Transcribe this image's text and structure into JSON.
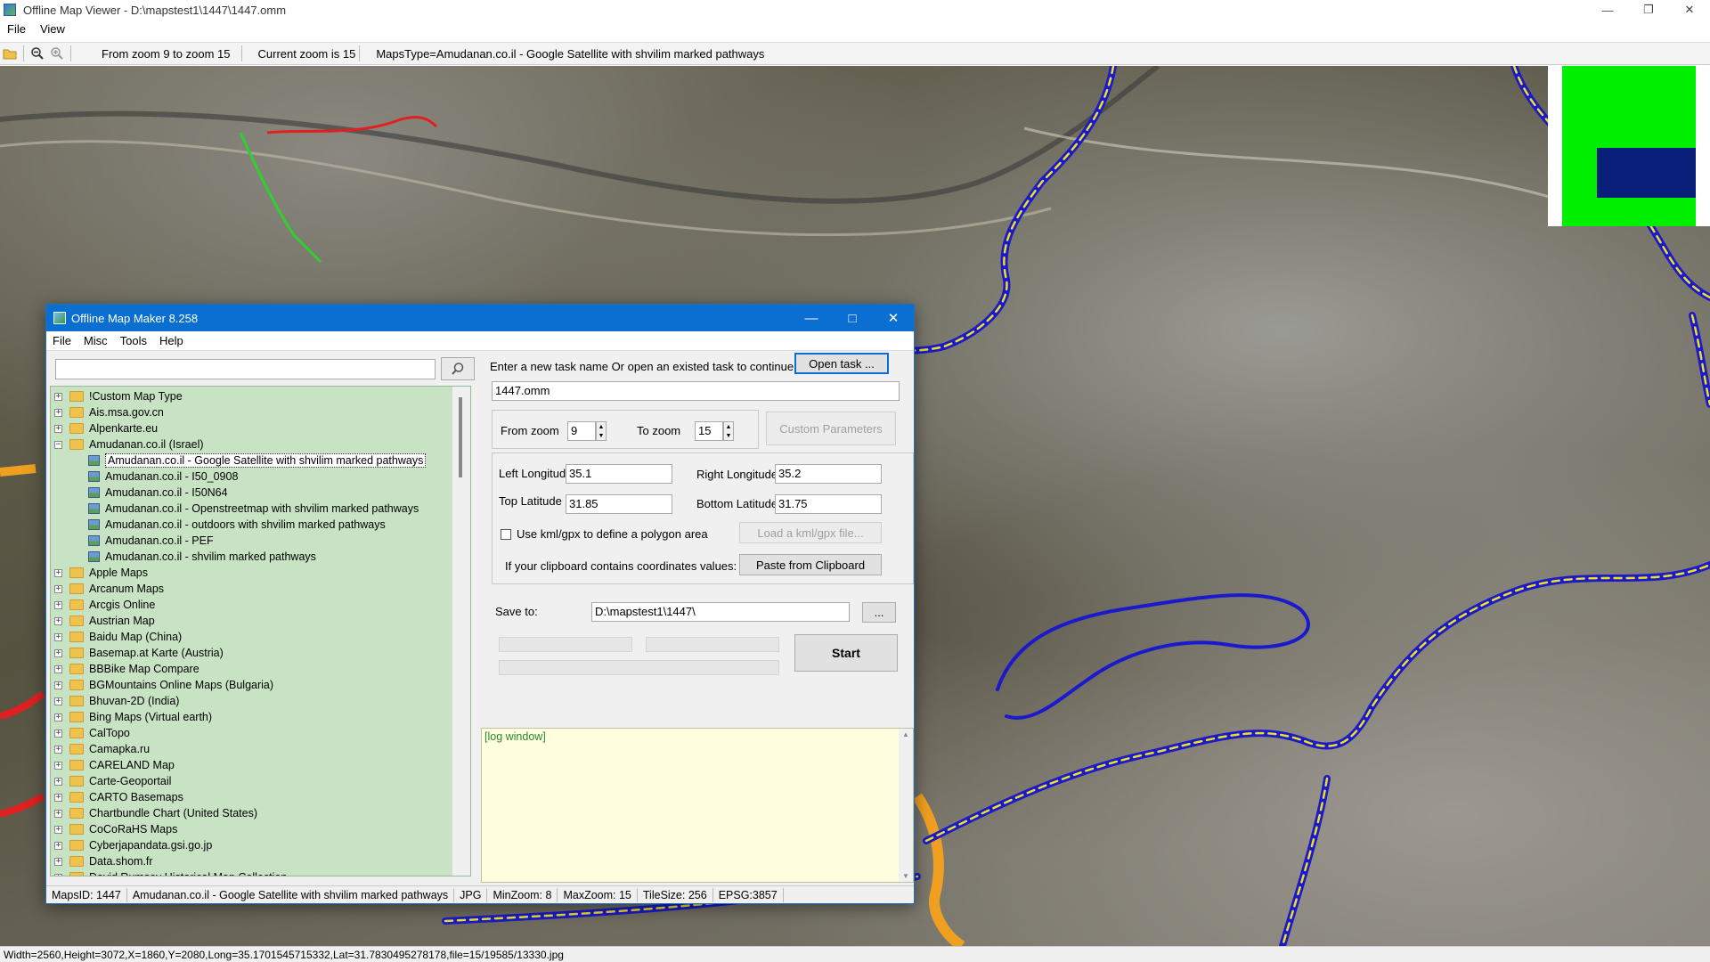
{
  "window": {
    "title": "Offline Map Viewer - D:\\mapstest1\\1447\\1447.omm"
  },
  "menu": [
    "File",
    "View"
  ],
  "toolbar": {
    "zoom_range": "From zoom 9 to zoom 15",
    "current_zoom": "Current zoom is 15",
    "maps_type": "MapsType=Amudanan.co.il - Google Satellite with shvilim marked pathways"
  },
  "status_bar": "Width=2560,Height=3072,X=1860,Y=2080,Long=35.1701545715332,Lat=31.7830495278178,file=15/19585/13330.jpg",
  "dialog": {
    "title": "Offline Map Maker 8.258",
    "menu": [
      "File",
      "Misc",
      "Tools",
      "Help"
    ],
    "search": {
      "value": "",
      "placeholder": ""
    },
    "tree": [
      {
        "label": "!Custom Map Type",
        "expanded": false
      },
      {
        "label": "Ais.msa.gov.cn",
        "expanded": false
      },
      {
        "label": "Alpenkarte.eu",
        "expanded": false
      },
      {
        "label": "Amudanan.co.il (Israel)",
        "expanded": true,
        "children": [
          {
            "label": "Amudanan.co.il - Google Satellite with shvilim marked pathways",
            "selected": true
          },
          {
            "label": "Amudanan.co.il - I50_0908"
          },
          {
            "label": "Amudanan.co.il - I50N64"
          },
          {
            "label": "Amudanan.co.il - Openstreetmap with shvilim marked pathways"
          },
          {
            "label": "Amudanan.co.il - outdoors with shvilim marked pathways"
          },
          {
            "label": "Amudanan.co.il - PEF"
          },
          {
            "label": "Amudanan.co.il - shvilim marked pathways"
          }
        ]
      },
      {
        "label": "Apple Maps",
        "expanded": false
      },
      {
        "label": "Arcanum Maps",
        "expanded": false
      },
      {
        "label": "Arcgis Online",
        "expanded": false
      },
      {
        "label": "Austrian Map",
        "expanded": false
      },
      {
        "label": "Baidu Map (China)",
        "expanded": false
      },
      {
        "label": "Basemap.at Karte (Austria)",
        "expanded": false
      },
      {
        "label": "BBBike Map Compare",
        "expanded": false
      },
      {
        "label": "BGMountains Online Maps (Bulgaria)",
        "expanded": false
      },
      {
        "label": "Bhuvan-2D (India)",
        "expanded": false
      },
      {
        "label": "Bing Maps (Virtual earth)",
        "expanded": false
      },
      {
        "label": "CalTopo",
        "expanded": false
      },
      {
        "label": "Camapka.ru",
        "expanded": false
      },
      {
        "label": "CARELAND Map",
        "expanded": false
      },
      {
        "label": "Carte-Geoportail",
        "expanded": false
      },
      {
        "label": "CARTO Basemaps",
        "expanded": false
      },
      {
        "label": "Chartbundle Chart (United States)",
        "expanded": false
      },
      {
        "label": "CoCoRaHS Maps",
        "expanded": false
      },
      {
        "label": "Cyberjapandata.gsi.go.jp",
        "expanded": false
      },
      {
        "label": "Data.shom.fr",
        "expanded": false
      },
      {
        "label": "David Rumsey Historical Map Collection",
        "expanded": false
      }
    ],
    "task": {
      "prompt": "Enter a new task name Or open an existed task to continue:",
      "open_button": "Open task ...",
      "name": "1447.omm"
    },
    "zoom": {
      "from_label": "From zoom",
      "from_value": "9",
      "to_label": "To zoom",
      "to_value": "15",
      "custom_button": "Custom Parameters"
    },
    "bounds": {
      "left_lon_label": "Left Longitude",
      "left_lon": "35.1",
      "right_lon_label": "Right Longitude",
      "right_lon": "35.2",
      "top_lat_label": "Top Latitude",
      "top_lat": "31.85",
      "bottom_lat_label": "Bottom Latitude",
      "bottom_lat": "31.75",
      "kml_checkbox_label": "Use kml/gpx to define a polygon area",
      "kml_checked": false,
      "kml_button": "Load a kml/gpx file...",
      "clipboard_label": "If your clipboard contains coordinates values:",
      "clipboard_button": "Paste from Clipboard"
    },
    "save": {
      "label": "Save to:",
      "path": "D:\\mapstest1\\1447\\",
      "browse_button": "..."
    },
    "start_button": "Start",
    "log": "[log window]",
    "status": {
      "maps_id": "MapsID: 1447",
      "map_name": "Amudanan.co.il - Google Satellite with shvilim marked pathways",
      "format": "JPG",
      "min_zoom": "MinZoom: 8",
      "max_zoom": "MaxZoom: 15",
      "tile_size": "TileSize: 256",
      "epsg": "EPSG:3857"
    }
  },
  "colors": {
    "dialog_title_bg": "#0a6fd1",
    "tree_bg": "#c8e3c4",
    "log_bg": "#ffffe0",
    "trail_blue": "#1a1acc",
    "trail_yellow": "#f0e020",
    "minimap_green": "#00ee00",
    "minimap_viewport": "#0a1f7a"
  }
}
